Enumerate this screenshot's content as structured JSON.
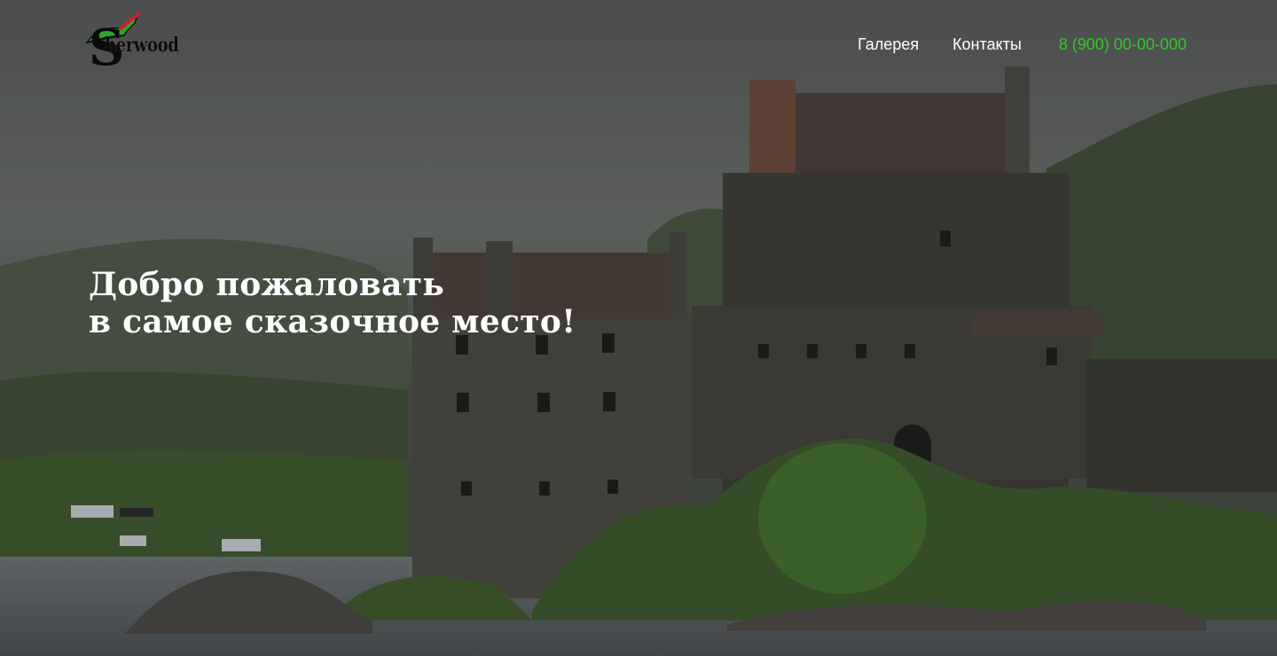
{
  "brand": {
    "name": "Sherwood",
    "initial": "S",
    "rest": "herwood",
    "hat_color": "#2fa52a",
    "feather_color": "#c8242a"
  },
  "nav": {
    "items": [
      {
        "label": "Галерея"
      },
      {
        "label": "Контакты"
      }
    ],
    "phone": "8 (900) 00-00-000",
    "phone_color": "#35c72c"
  },
  "hero": {
    "line1": "Добро пожаловать",
    "line2": "в самое сказочное место!"
  }
}
